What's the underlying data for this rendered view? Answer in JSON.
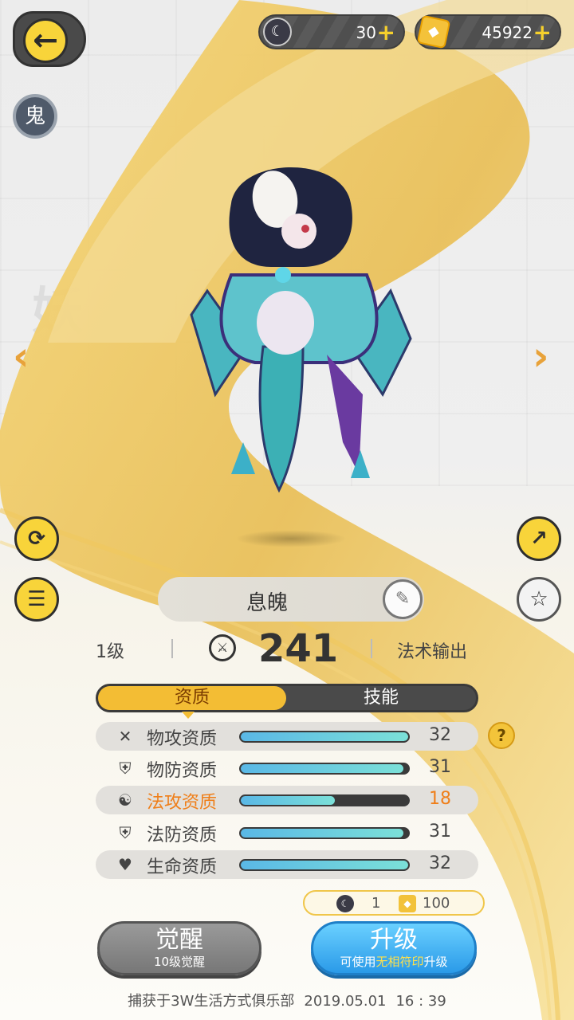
{
  "currency": {
    "spirit_value": "30",
    "gold_value": "45922"
  },
  "type_badge": "鬼",
  "character": {
    "name": "息魄",
    "level": "1级",
    "power": "241",
    "role": "法术输出"
  },
  "tabs": {
    "active": "资质",
    "other": "技能"
  },
  "attributes": [
    {
      "label": "物攻资质",
      "value": "32",
      "icon": "crossed-swords-icon",
      "fraction": 1.0
    },
    {
      "label": "物防资质",
      "value": "31",
      "icon": "shield-icon",
      "fraction": 0.97
    },
    {
      "label": "法攻资质",
      "value": "18",
      "icon": "magic-swirl-icon",
      "fraction": 0.56
    },
    {
      "label": "法防资质",
      "value": "31",
      "icon": "magic-shield-icon",
      "fraction": 0.97
    },
    {
      "label": "生命资质",
      "value": "32",
      "icon": "heart-icon",
      "fraction": 1.0
    }
  ],
  "cost": {
    "spirit": "1",
    "gold": "100"
  },
  "buttons": {
    "awaken_title": "觉醒",
    "awaken_sub": "10级觉醒",
    "upgrade_title": "升级",
    "upgrade_sub_pre": "可使用",
    "upgrade_sub_hl": "无相符印",
    "upgrade_sub_post": "升级"
  },
  "footer": {
    "caught_at": "捕获于3W生活方式俱乐部",
    "date": "2019.05.01",
    "time": "16 : 39"
  },
  "colors": {
    "accent_yellow": "#f8d43a",
    "highlight_orange": "#ef7f1a",
    "upgrade_blue": "#2a9ae8"
  }
}
